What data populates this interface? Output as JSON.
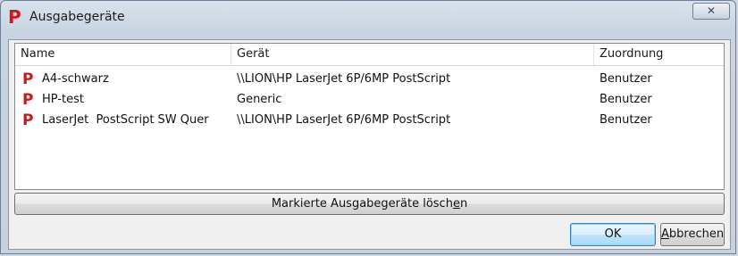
{
  "window": {
    "title": "Ausgabegeräte",
    "app_icon_glyph": "P",
    "close_glyph": "✕"
  },
  "table": {
    "columns": [
      "Name",
      "Gerät",
      "Zuordnung"
    ],
    "rows": [
      {
        "icon": "printer-p-icon",
        "glyph": "P",
        "name": "A4-schwarz",
        "device": "\\\\LION\\HP LaserJet 6P/6MP PostScript",
        "assignment": "Benutzer"
      },
      {
        "icon": "printer-p-icon",
        "glyph": "P",
        "name": "HP-test",
        "device": "Generic",
        "assignment": "Benutzer"
      },
      {
        "icon": "printer-p-icon",
        "glyph": "P",
        "name": "LaserJet  PostScript SW Quer",
        "device": "\\\\LION\\HP LaserJet 6P/6MP PostScript",
        "assignment": "Benutzer"
      }
    ]
  },
  "buttons": {
    "delete_label_main": "Markierte Ausgabegeräte lösch",
    "delete_label_mnemonic": "e",
    "delete_label_rest": "n",
    "ok_label": "OK",
    "cancel_mnemonic": "A",
    "cancel_rest": "bbrechen"
  },
  "colors": {
    "brand_red": "#d4141c",
    "ok_accent": "#3c7fb1"
  }
}
